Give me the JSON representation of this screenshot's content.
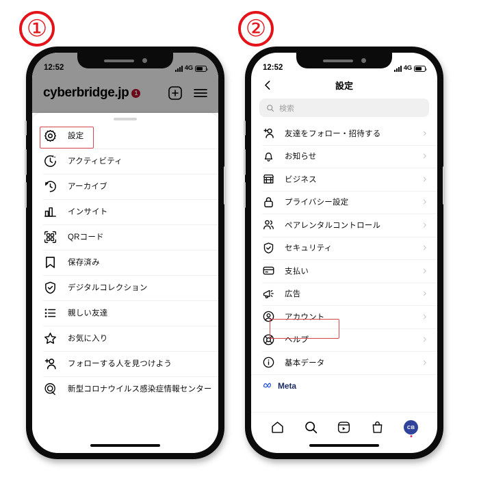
{
  "steps": [
    {
      "number": "①",
      "badge_color": "#e3131a"
    },
    {
      "number": "②",
      "badge_color": "#e3131a"
    }
  ],
  "phone1": {
    "status_bar": {
      "time": "12:52",
      "network": "4G",
      "signal_icon": "signal-bars-icon",
      "battery_icon": "battery-icon"
    },
    "app_bar": {
      "brand": "cyberbridge.jp",
      "badge_count": "1",
      "add_button_label": "新規投稿",
      "add_icon": "plus-box-icon",
      "menu_icon": "hamburger-menu-icon"
    },
    "menu": {
      "items": [
        {
          "label": "設定",
          "icon": "gear-icon",
          "highlighted": true
        },
        {
          "label": "アクティビティ",
          "icon": "activity-clock-icon",
          "highlighted": false
        },
        {
          "label": "アーカイブ",
          "icon": "archive-clock-icon",
          "highlighted": false
        },
        {
          "label": "インサイト",
          "icon": "insights-bar-chart-icon",
          "highlighted": false
        },
        {
          "label": "QRコード",
          "icon": "qr-code-icon",
          "highlighted": false
        },
        {
          "label": "保存済み",
          "icon": "bookmark-icon",
          "highlighted": false
        },
        {
          "label": "デジタルコレクション",
          "icon": "shield-check-icon",
          "highlighted": false
        },
        {
          "label": "親しい友達",
          "icon": "close-friends-list-icon",
          "highlighted": false
        },
        {
          "label": "お気に入り",
          "icon": "star-icon",
          "highlighted": false
        },
        {
          "label": "フォローする人を見つけよう",
          "icon": "add-person-icon",
          "highlighted": false
        },
        {
          "label": "新型コロナウイルス感染症情報センター",
          "icon": "covid-info-icon",
          "highlighted": false
        }
      ]
    },
    "highlight_color": "#d9454f"
  },
  "phone2": {
    "status_bar": {
      "time": "12:52",
      "network": "4G",
      "signal_icon": "signal-bars-icon",
      "battery_icon": "battery-icon"
    },
    "nav_bar": {
      "back_icon": "chevron-left-icon",
      "title": "設定"
    },
    "search": {
      "placeholder": "検索",
      "icon": "search-icon"
    },
    "settings": {
      "items": [
        {
          "label": "友達をフォロー・招待する",
          "icon": "add-person-icon",
          "chevron": "chevron-right-icon",
          "highlighted": false
        },
        {
          "label": "お知らせ",
          "icon": "bell-icon",
          "chevron": "chevron-right-icon",
          "highlighted": false
        },
        {
          "label": "ビジネス",
          "icon": "storefront-icon",
          "chevron": "chevron-right-icon",
          "highlighted": false
        },
        {
          "label": "プライバシー設定",
          "icon": "lock-icon",
          "chevron": "chevron-right-icon",
          "highlighted": false
        },
        {
          "label": "ペアレンタルコントロール",
          "icon": "people-icon",
          "chevron": "chevron-right-icon",
          "highlighted": false
        },
        {
          "label": "セキュリティ",
          "icon": "shield-check-icon",
          "chevron": "chevron-right-icon",
          "highlighted": false
        },
        {
          "label": "支払い",
          "icon": "credit-card-icon",
          "chevron": "chevron-right-icon",
          "highlighted": false
        },
        {
          "label": "広告",
          "icon": "megaphone-icon",
          "chevron": "chevron-right-icon",
          "highlighted": false
        },
        {
          "label": "アカウント",
          "icon": "account-circle-icon",
          "chevron": "chevron-right-icon",
          "highlighted": true
        },
        {
          "label": "ヘルプ",
          "icon": "help-lifebuoy-icon",
          "chevron": "chevron-right-icon",
          "highlighted": false
        },
        {
          "label": "基本データ",
          "icon": "info-circle-icon",
          "chevron": "chevron-right-icon",
          "highlighted": false
        }
      ]
    },
    "meta": {
      "label": "Meta",
      "icon": "meta-infinity-icon",
      "color": "#1b2a5e"
    },
    "tab_bar": {
      "tabs": [
        {
          "name": "home",
          "icon": "home-icon"
        },
        {
          "name": "search",
          "icon": "search-icon"
        },
        {
          "name": "reels",
          "icon": "reels-play-icon"
        },
        {
          "name": "shop",
          "icon": "shopping-bag-icon"
        }
      ],
      "profile": {
        "initials": "CB",
        "avatar_color": "#2e4399",
        "has_notification_dot": true
      }
    },
    "highlight_color": "#d9454f"
  }
}
